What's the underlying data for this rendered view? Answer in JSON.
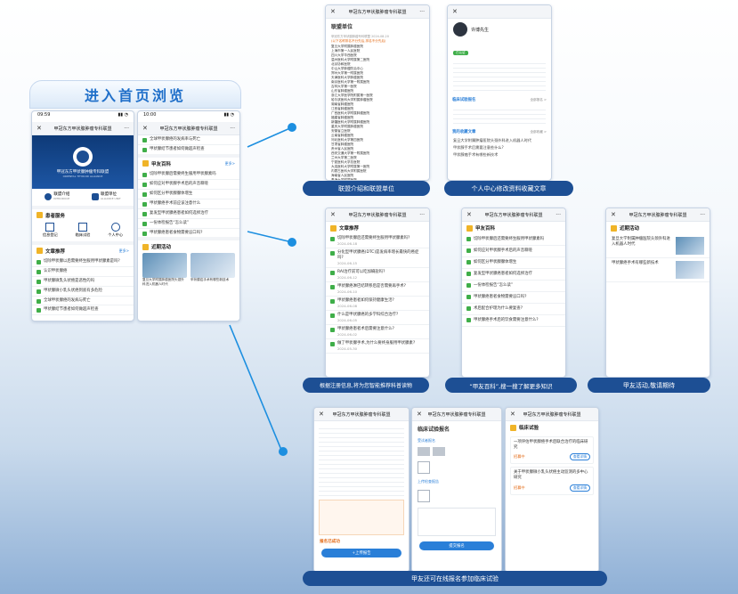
{
  "colors": {
    "brand_blue": "#1d4f94",
    "accent_blue": "#1d8fe0",
    "green": "#3fae49",
    "orange": "#f0b428"
  },
  "banner": {
    "title": "进入首页浏览"
  },
  "app_name": "甲冠东方甲状腺肿瘤专科联盟",
  "phone1": {
    "time": "09:59",
    "logo_title": "甲冠东方甲状腺肿瘤专科联盟",
    "logo_sub": "ORIENTAL THYROID ALLIANCE",
    "intro_label": "联盟介绍",
    "intro_en": "INTRODUCE",
    "unit_label": "联盟单位",
    "unit_en": "ALLIANCE UNIT",
    "service_title": "患者服务",
    "services": [
      "信息登记",
      "临床试验",
      "个人中心"
    ],
    "rec_title": "文章推荐",
    "more": "更多>",
    "articles": [
      "切除甲状腺以后需要终生服用甲状腺素是吗?",
      "认识甲状腺癌",
      "甲状腺微乳头状癌是恶性的吗",
      "甲状腺微小乳头状癌到底有多危险",
      "全球甲状腺癌的发病与死亡",
      "甲状腺结节患者如何做超声检查"
    ]
  },
  "phone2": {
    "time": "10:00",
    "top_articles": [
      "全球甲状腺癌的发病率与死亡",
      "甲状腺结节患者如何做超声检查"
    ],
    "wiki_title": "甲友百科",
    "more": "更多>",
    "wiki": [
      "切除甲状腺后需要终生服用甲状腺素吗",
      "如何应对甲状腺手术后的声音嘶哑",
      "如何区分甲状腺腺体增生",
      "甲状腺癌手术前应该注意什么",
      "复发型甲状腺癌患者如何选择治疗",
      "一份体检报告“怎么读”",
      "甲状腺癌患者食物需要忌口吗?"
    ],
    "activity_title": "近期活动",
    "cards": [
      "复旦大学附属肿瘤医院头颈外科进入机器人时代",
      "甲状腺癌手术有哪些新技术"
    ]
  },
  "p3": {
    "title": "联盟单位",
    "subtitle": "甲冠东方甲状腺肿瘤专科联盟 2024-08-20",
    "note": "(以下名称排名不分先后,排名不分先后)",
    "units": [
      "复旦大学附属肿瘤医院",
      "上海市第一人民医院",
      "四川大学华西医院",
      "温州医科大学附属第二医院",
      "北京协和医院",
      "中山大学肿瘤防治中心",
      "郑州大学第一附属医院",
      "天津医科大学肿瘤医院",
      "南京医科大学第一附属医院",
      "吉林大学第一医院",
      "山东省肿瘤医院",
      "浙江大学医学院附属第一医院",
      "哈尔滨医科大学附属肿瘤医院",
      "湖南省肿瘤医院",
      "江西省肿瘤医院",
      "广西医科大学附属肿瘤医院",
      "福建省肿瘤医院",
      "新疆医科大学附属肿瘤医院",
      "重庆大学附属肿瘤医院",
      "安徽省立医院",
      "云南省肿瘤医院",
      "河北医科大学第四医院",
      "甘肃省肿瘤医院",
      "贵州省人民医院",
      "西安交通大学第一附属医院",
      "兰州大学第二医院",
      "宁夏医科大学总医院",
      "大连医科大学附属第一医院",
      "内蒙古医科大学附属医院",
      "海南省人民医院",
      "青海大学附属医院",
      "西藏自治区人民医院",
      "上海交通大学医学院附属瑞金医院",
      "上海市第十人民医院"
    ]
  },
  "p4": {
    "name": "许博先生",
    "badge": "已认证",
    "fav_title": "我的收藏文章",
    "fav_more": "全部收藏 >",
    "favs": [
      "复旦大学附属肿瘤医院头颈外科进入机器人时代",
      "甲状腺手术后需要注意些什么?",
      "甲状腺癌手术有哪些新技术"
    ],
    "trial_title": "临床试验报名",
    "trial_more": "全部报名 >"
  },
  "p5": {
    "title": "文章推荐",
    "items": [
      {
        "t": "切除甲状腺后还需要终生服用甲状腺素吗?",
        "d": "2024-06-18"
      },
      {
        "t": "分化型甲状腺癌(DTC)是发病率增长最快的癌症吗?",
        "d": "2024-06-15"
      },
      {
        "t": "RAI治疗前可以吃加碘盐吗?",
        "d": "2024-06-12"
      },
      {
        "t": "甲状腺癌淋巴结转移后是否需要再手术?",
        "d": "2024-06-10"
      },
      {
        "t": "甲状腺癌患者如何保持健康生活?",
        "d": "2024-06-08"
      },
      {
        "t": "什么是甲状腺癌的多学科综合治疗?",
        "d": "2024-06-05"
      },
      {
        "t": "甲状腺癌患者术后需要注意什么?",
        "d": "2024-06-02"
      },
      {
        "t": "做了甲状腺手术,为什么要终身服用甲状腺素?",
        "d": "2024-05-30"
      }
    ]
  },
  "p6": {
    "title": "甲友百科",
    "items": [
      "切除甲状腺后还需要终生服用甲状腺素吗",
      "如何应对甲状腺手术后的声音嘶哑",
      "如何区分甲状腺腺体增生",
      "复发型甲状腺癌患者如何选择治疗",
      "一份体检报告“怎么读”",
      "甲状腺癌患者食物需要忌口吗?",
      "术后配合护理为什么要复查?",
      "甲状腺癌手术后的饮食需要注意什么?"
    ]
  },
  "p7": {
    "title": "近期活动",
    "items": [
      "复旦大学附属肿瘤医院头颈外科进入机器人时代",
      "甲状腺癌手术有哪些新技术"
    ]
  },
  "p8": {
    "title": "临床试验报名",
    "sub1": "受试者报名",
    "sub2": "上传检查报告",
    "signup": "报名已成功",
    "upload_btn": "+上传报告",
    "submit": "提交报名"
  },
  "p9": {
    "title": "临床试验",
    "status": "招募中",
    "view": "查看详情",
    "trials": [
      "一项评估甲状腺癌手术后联合治疗的临床研究",
      "关于甲状腺微小乳头状癌主动监测的多中心研究"
    ]
  },
  "labels": [
    "联盟介绍和联盟单位",
    "个人中心修改资料收藏文章",
    "根据注册信息,将为您智能推荐科普读物",
    "“甲友百科”,搜一搜了解更多知识",
    "甲友活动,敬请期待",
    "甲友还可在线报名参加临床试验"
  ]
}
